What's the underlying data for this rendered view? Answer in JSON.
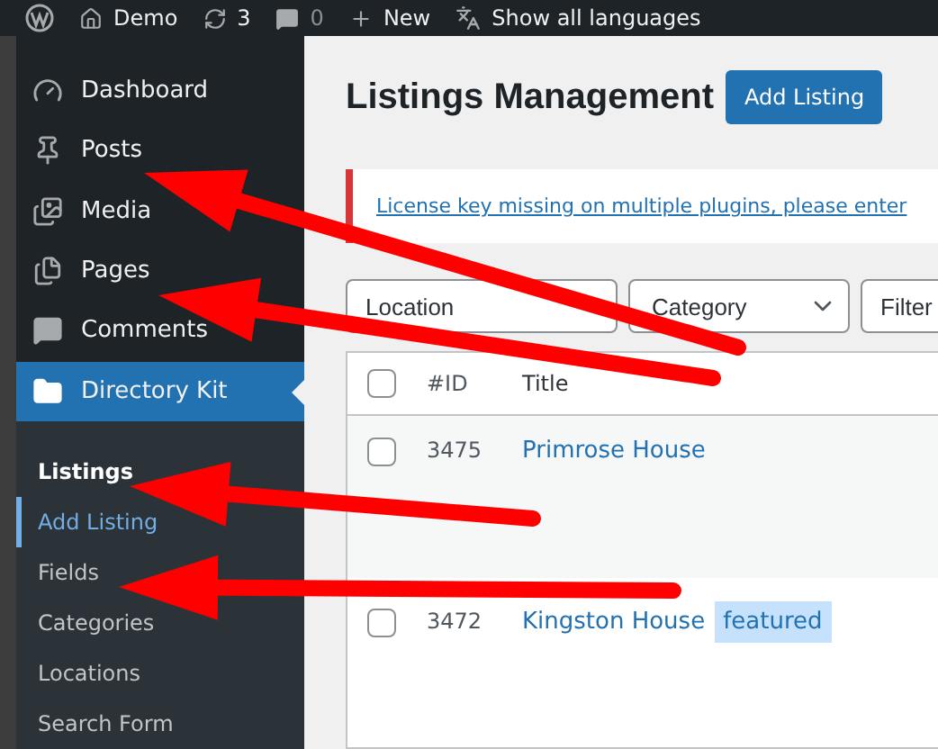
{
  "admin_bar": {
    "site": "Demo",
    "updates": "3",
    "comments": "0",
    "new": "New",
    "languages": "Show all languages"
  },
  "sidebar": {
    "items": [
      {
        "label": "Dashboard",
        "kind": "dashboard",
        "selected": false
      },
      {
        "label": "Posts",
        "kind": "posts",
        "selected": false
      },
      {
        "label": "Media",
        "kind": "media",
        "selected": false
      },
      {
        "label": "Pages",
        "kind": "pages",
        "selected": false
      },
      {
        "label": "Comments",
        "kind": "comments",
        "selected": false
      },
      {
        "label": "Directory Kit",
        "kind": "folder",
        "selected": true
      }
    ],
    "submenu": [
      {
        "label": "Listings",
        "selected": true,
        "hovered": false
      },
      {
        "label": "Add Listing",
        "selected": false,
        "hovered": true
      },
      {
        "label": "Fields",
        "selected": false,
        "hovered": false
      },
      {
        "label": "Categories",
        "selected": false,
        "hovered": false
      },
      {
        "label": "Locations",
        "selected": false,
        "hovered": false
      },
      {
        "label": "Search Form",
        "selected": false,
        "hovered": false
      }
    ]
  },
  "page": {
    "title": "Listings Management",
    "add_button": "Add Listing"
  },
  "notice": {
    "link": "License key missing on multiple plugins, please enter"
  },
  "filters": {
    "location": {
      "placeholder": "Location"
    },
    "category": {
      "value": "Category"
    },
    "filter": {
      "placeholder": "Filter"
    }
  },
  "table": {
    "columns": [
      "#ID",
      "Title"
    ],
    "select_all_checked": false,
    "rows": [
      {
        "id": "3475",
        "title": "Primrose House",
        "checked": false
      },
      {
        "id": "3472",
        "title": "Kingston House",
        "tag": "featured",
        "checked": false
      }
    ]
  }
}
